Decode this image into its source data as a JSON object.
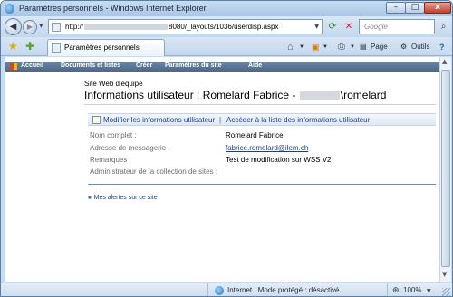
{
  "window": {
    "title": "Paramètres personnels - Windows Internet Explorer",
    "min_label": "–",
    "max_label": "□",
    "close_label": "x"
  },
  "addressbar": {
    "url_prefix": "http://",
    "url_suffix": "8080/_layouts/1036/userdisp.aspx",
    "search_placeholder": "Google"
  },
  "tabs": [
    {
      "label": "Paramètres personnels"
    }
  ],
  "toolbar": {
    "page_label": "Page",
    "tools_label": "Outils"
  },
  "sharepoint": {
    "nav": [
      "Accueil",
      "Documents et listes",
      "Créer",
      "Paramètres du site",
      "Aide"
    ],
    "site_name": "Site Web d'équipe",
    "page_title_prefix": "Informations utilisateur : Romelard Fabrice -",
    "page_title_suffix": "\\romelard",
    "actions": {
      "edit": "Modifier les informations utilisateur",
      "separator": "|",
      "list": "Accéder à la liste des informations utilisateur"
    },
    "properties": [
      {
        "label": "Nom complet :",
        "value": "Romelard Fabrice"
      },
      {
        "label": "Adresse de messagerie :",
        "value": "fabrice.romelard@ilem.ch"
      },
      {
        "label": "Remarques :",
        "value": "Test de modification sur WSS V2"
      },
      {
        "label": "Administrateur de la collection de sites :",
        "value": ""
      }
    ],
    "alerts_link": "Mes alertes sur ce site"
  },
  "statusbar": {
    "zone": "Internet | Mode protégé : désactivé",
    "zoom": "100%"
  }
}
